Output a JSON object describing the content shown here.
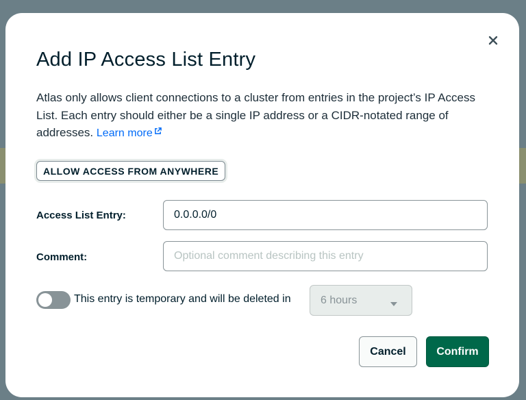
{
  "dialog": {
    "title": "Add IP Access List Entry",
    "description": "Atlas only allows client connections to a cluster from entries in the project’s IP Access List. Each entry should either be a single IP address or a CIDR-notated range of addresses. ",
    "learn_more_label": "Learn more",
    "allow_anywhere_label": "ALLOW ACCESS FROM ANYWHERE",
    "access_list_entry": {
      "label": "Access List Entry:",
      "value": "0.0.0.0/0"
    },
    "comment": {
      "label": "Comment:",
      "placeholder": "Optional comment describing this entry",
      "value": ""
    },
    "temporary": {
      "enabled": false,
      "text": "This entry is temporary and will be deleted in",
      "duration": "6 hours"
    },
    "cancel_label": "Cancel",
    "confirm_label": "Confirm"
  },
  "icons": {
    "close": "close-icon",
    "external_link": "external-link-icon",
    "dropdown": "caret-down-icon"
  },
  "colors": {
    "primary": "#00684a",
    "link": "#016bf8",
    "text": "#001e2b",
    "overlay": "#6b7f87"
  }
}
